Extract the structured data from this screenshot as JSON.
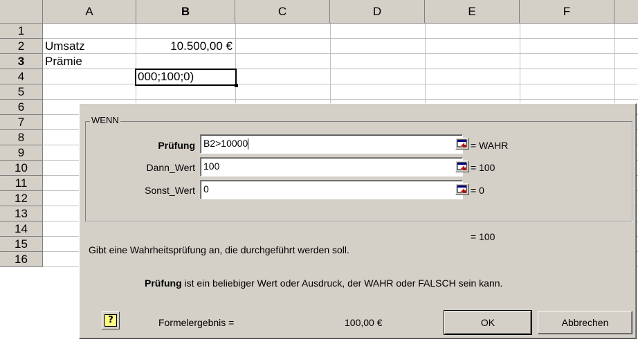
{
  "sheet": {
    "columns": [
      "A",
      "B",
      "C",
      "D",
      "E",
      "F"
    ],
    "selected_column": "B",
    "rows": [
      "1",
      "2",
      "3",
      "4",
      "5",
      "6",
      "7",
      "8",
      "9",
      "10",
      "11",
      "12",
      "13",
      "14",
      "15",
      "16"
    ],
    "selected_row": "3",
    "cells": {
      "a2": "Umsatz",
      "b2": "10.500,00 €",
      "a3": "Prämie",
      "b3_edit": "000;100;0)"
    }
  },
  "dialog": {
    "group_title": "WENN",
    "args": [
      {
        "label": "Prüfung",
        "value": "B2>10000",
        "result": "= WAHR"
      },
      {
        "label": "Dann_Wert",
        "value": "100",
        "result": "= 100"
      },
      {
        "label": "Sonst_Wert",
        "value": "0",
        "result": "= 0"
      }
    ],
    "overall_result": "= 100",
    "description": "Gibt eine Wahrheitsprüfung an, die durchgeführt werden soll.",
    "arg_help_name": "Prüfung",
    "arg_help_text": "ist ein beliebiger Wert oder Ausdruck, der WAHR oder FALSCH sein kann.",
    "formula_result_label": "Formelergebnis =",
    "formula_result_value": "100,00 €",
    "ok_label": "OK",
    "cancel_label": "Abbrechen",
    "help_icon": "question-mark-icon",
    "collapse_icon": "collapse-dialog-icon"
  }
}
